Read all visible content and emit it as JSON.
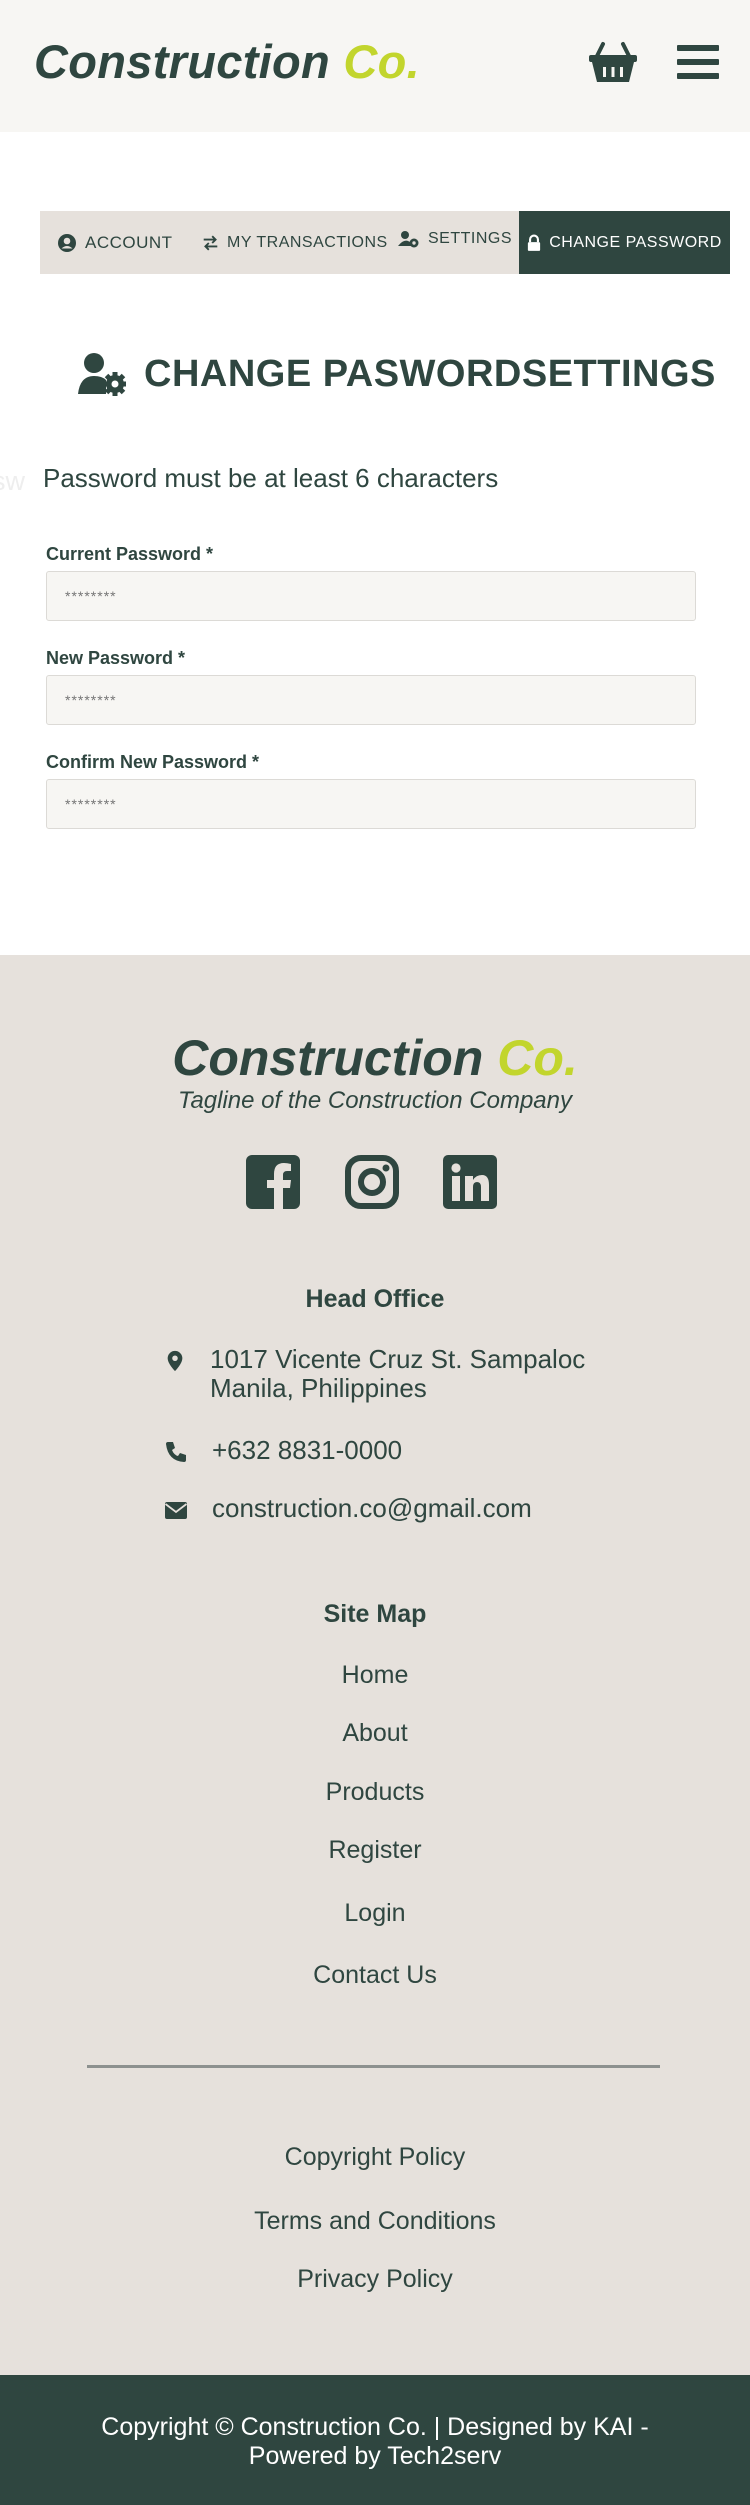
{
  "header": {
    "logo_main": "Construction",
    "logo_accent": "Co."
  },
  "tabs": [
    {
      "label": "ACCOUNT",
      "icon": "user-circle-icon"
    },
    {
      "label": "MY TRANSACTIONS",
      "icon": "exchange-icon"
    },
    {
      "label": "SETTINGS",
      "icon": "user-cog-icon"
    },
    {
      "label": "CHANGE PASSWORD",
      "icon": "lock-icon"
    }
  ],
  "page": {
    "title": "CHANGE PASWORDSETTINGS",
    "ghost": "sw",
    "hint": "Password must be at least 6 characters"
  },
  "form": {
    "fields": [
      {
        "label": "Current Password *",
        "placeholder": "********"
      },
      {
        "label": "New Password *",
        "placeholder": "********"
      },
      {
        "label": "Confirm New Password *",
        "placeholder": "********"
      }
    ]
  },
  "footer": {
    "logo_main": "Construction",
    "logo_accent": "Co.",
    "tagline": "Tagline of the Construction Company",
    "social": [
      "facebook-icon",
      "instagram-icon",
      "linkedin-icon"
    ],
    "head_office": {
      "heading": "Head Office",
      "address_line1": "1017 Vicente Cruz St. Sampaloc",
      "address_line2": "Manila, Philippines",
      "phone": "+632 8831-0000",
      "email": "construction.co@gmail.com"
    },
    "site_map": {
      "heading": "Site Map",
      "links": [
        "Home",
        "About",
        "Products",
        "Register",
        "Login",
        "Contact Us"
      ]
    },
    "policies": [
      "Copyright Policy",
      "Terms and Conditions",
      "Privacy Policy"
    ],
    "copyright_line1": "Copyright © Construction Co.  | Designed by KAI -",
    "copyright_line2": "Powered by Tech2serv"
  },
  "colors": {
    "primary": "#2f4640",
    "accent": "#c2d52d",
    "header_bg": "#f7f6f3",
    "footer_bg": "#e6e1dc"
  }
}
